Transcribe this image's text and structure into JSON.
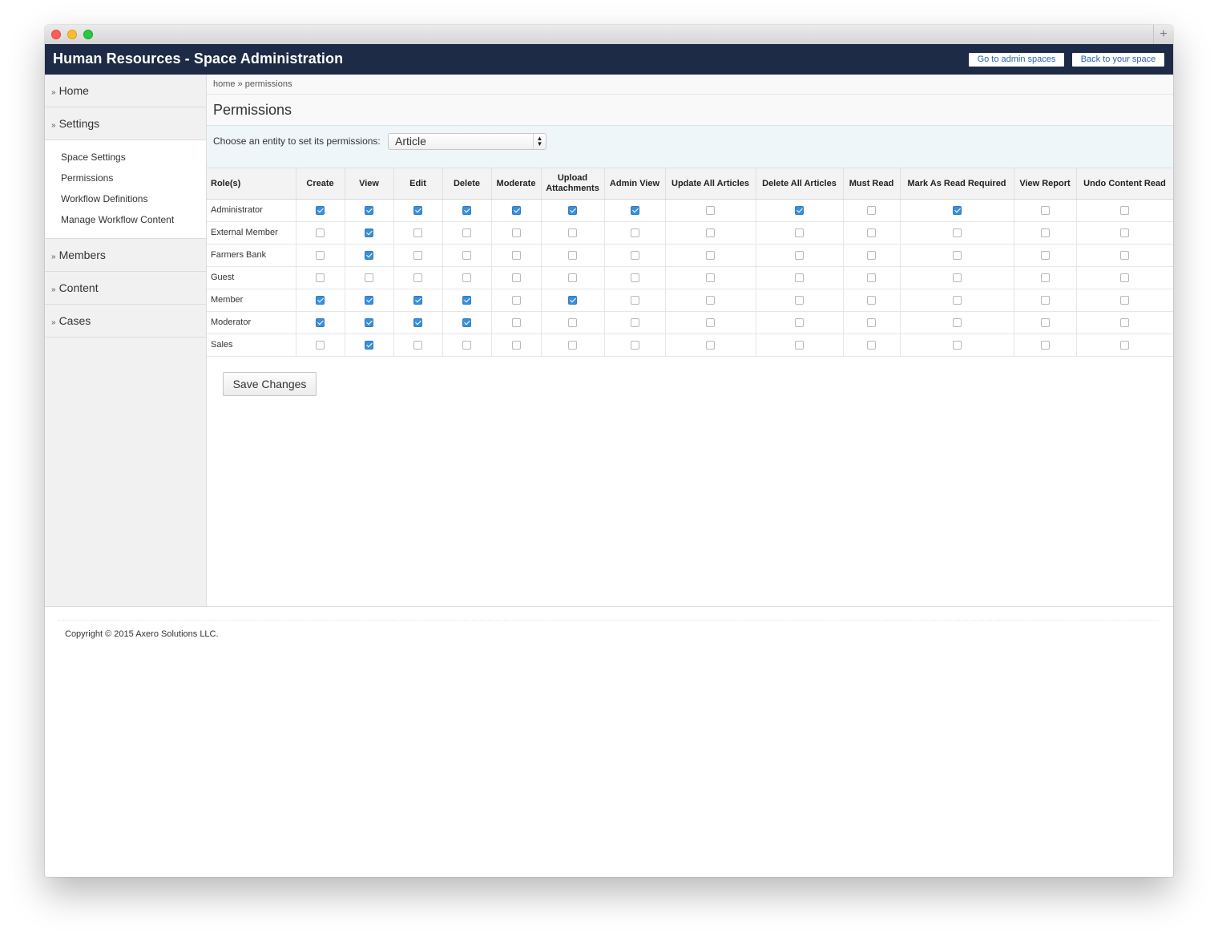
{
  "window": {
    "new_tab_symbol": "+"
  },
  "header": {
    "title": "Human Resources - Space Administration",
    "go_admin_label": "Go to admin spaces",
    "back_label": "Back to your space"
  },
  "sidebar": {
    "home": "Home",
    "settings": "Settings",
    "settings_sub": [
      "Space Settings",
      "Permissions",
      "Workflow Definitions",
      "Manage Workflow Content"
    ],
    "members": "Members",
    "content": "Content",
    "cases": "Cases",
    "arrow": "»"
  },
  "breadcrumb": {
    "home": "home",
    "sep": "»",
    "current": "permissions"
  },
  "page_title": "Permissions",
  "entity": {
    "label": "Choose an entity to set its permissions:",
    "selected": "Article"
  },
  "table": {
    "role_header": "Role(s)",
    "columns": [
      "Create",
      "View",
      "Edit",
      "Delete",
      "Moderate",
      "Upload Attachments",
      "Admin View",
      "Update All Articles",
      "Delete All Articles",
      "Must Read",
      "Mark As Read Required",
      "View Report",
      "Undo Content Read"
    ],
    "rows": [
      {
        "role": "Administrator",
        "checks": [
          1,
          1,
          1,
          1,
          1,
          1,
          1,
          0,
          1,
          0,
          1,
          0,
          0
        ]
      },
      {
        "role": "External Member",
        "checks": [
          0,
          1,
          0,
          0,
          0,
          0,
          0,
          0,
          0,
          0,
          0,
          0,
          0
        ]
      },
      {
        "role": "Farmers Bank",
        "checks": [
          0,
          1,
          0,
          0,
          0,
          0,
          0,
          0,
          0,
          0,
          0,
          0,
          0
        ]
      },
      {
        "role": "Guest",
        "checks": [
          0,
          0,
          0,
          0,
          0,
          0,
          0,
          0,
          0,
          0,
          0,
          0,
          0
        ]
      },
      {
        "role": "Member",
        "checks": [
          1,
          1,
          1,
          1,
          0,
          1,
          0,
          0,
          0,
          0,
          0,
          0,
          0
        ]
      },
      {
        "role": "Moderator",
        "checks": [
          1,
          1,
          1,
          1,
          0,
          0,
          0,
          0,
          0,
          0,
          0,
          0,
          0
        ]
      },
      {
        "role": "Sales",
        "checks": [
          0,
          1,
          0,
          0,
          0,
          0,
          0,
          0,
          0,
          0,
          0,
          0,
          0
        ]
      }
    ]
  },
  "save_label": "Save Changes",
  "footer": {
    "copyright": "Copyright © 2015 Axero Solutions LLC."
  },
  "colors": {
    "header_bg": "#1e2b46",
    "checkbox_checked": "#3b8fd9",
    "link": "#2d64a8"
  }
}
